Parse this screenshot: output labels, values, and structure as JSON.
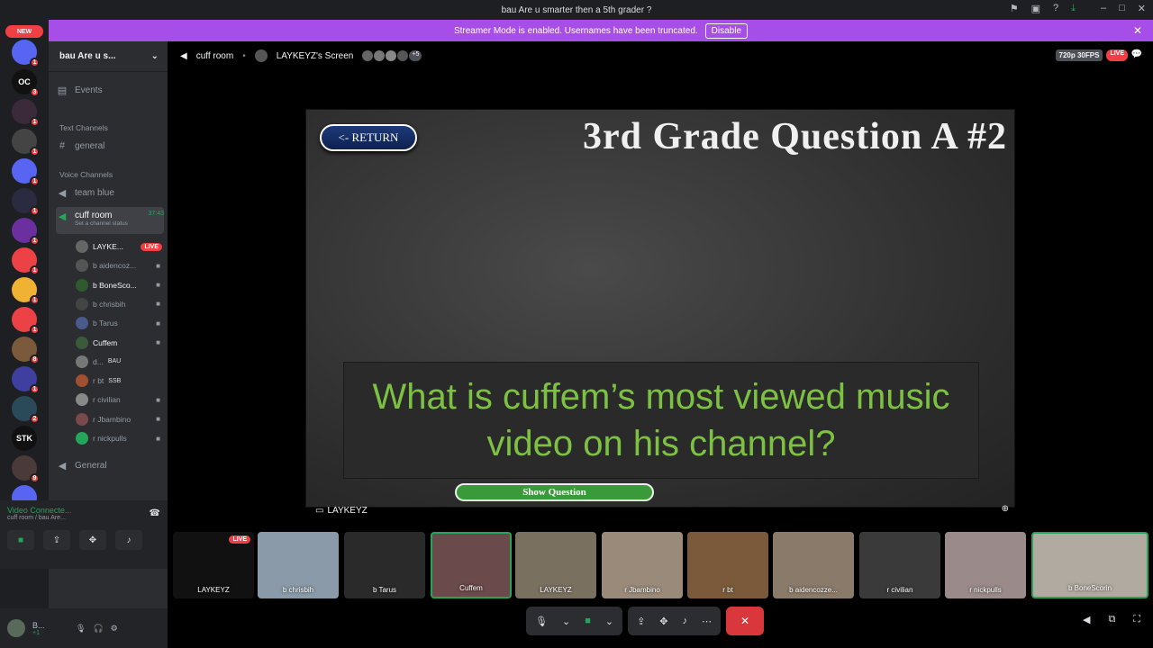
{
  "window": {
    "title": "bau Are u smarter then a 5th grader ?"
  },
  "banner": {
    "text": "Streamer Mode is enabled. Usernames have been truncated.",
    "button": "Disable"
  },
  "servers": [
    {
      "label": "",
      "badge": "1",
      "color": "#5865f2"
    },
    {
      "label": "OC",
      "badge": "3",
      "color": "#111"
    },
    {
      "label": "",
      "badge": "1",
      "color": "#3b2a3a"
    },
    {
      "label": "",
      "badge": "1",
      "color": "#444"
    },
    {
      "label": "",
      "badge": "1",
      "color": "#5865f2"
    },
    {
      "label": "",
      "badge": "1",
      "color": "#2a2a40"
    },
    {
      "label": "",
      "badge": "1",
      "color": "#6b2fa0"
    },
    {
      "label": "",
      "badge": "1",
      "color": "#ed4245"
    },
    {
      "label": "",
      "badge": "1",
      "color": "#f0b232"
    },
    {
      "label": "",
      "badge": "1",
      "color": "#ed4245"
    },
    {
      "label": "",
      "badge": "8",
      "color": "#7a5a3a"
    },
    {
      "label": "",
      "badge": "1",
      "color": "#3f3fa0"
    },
    {
      "label": "",
      "badge": "2",
      "color": "#2a4a5a"
    },
    {
      "label": "STK",
      "badge": "",
      "color": "#111"
    },
    {
      "label": "",
      "badge": "9",
      "color": "#4a3a3a"
    },
    {
      "label": "",
      "badge": "",
      "color": "#5865f2"
    }
  ],
  "new_label": "NEW",
  "guild": {
    "name": "bau Are u s..."
  },
  "sidebar": {
    "events": "Events",
    "text_category": "Text Channels",
    "general": "general",
    "voice_category": "Voice Channels",
    "team_blue": "team blue",
    "cuff_room": "cuff room",
    "timer": "37:43",
    "status_hint": "Set a channel status",
    "general2": "General"
  },
  "voice_users": [
    {
      "name": "LAYKE...",
      "tag": "LIVE"
    },
    {
      "name": "b aidencoz...",
      "tag": ""
    },
    {
      "name": "b BoneSco...",
      "tag": ""
    },
    {
      "name": "b chrisbih",
      "tag": ""
    },
    {
      "name": "b Tarus",
      "tag": ""
    },
    {
      "name": "Cuffem",
      "tag": ""
    },
    {
      "name": "d...",
      "tag": "BAU"
    },
    {
      "name": "r bt",
      "tag": "SSB"
    },
    {
      "name": "r civilian",
      "tag": ""
    },
    {
      "name": "r Jbambino",
      "tag": ""
    },
    {
      "name": "r nickpulls",
      "tag": ""
    }
  ],
  "voice_panel": {
    "status": "Video Connecte...",
    "location": "cuff room / bau Are..."
  },
  "user_panel": {
    "name": "B...",
    "sub": "+1"
  },
  "stage_header": {
    "channel": "cuff room",
    "screen": "LAYKEYZ's Screen",
    "more": "+5",
    "quality": "720p 30FPS",
    "live": "LIVE"
  },
  "board": {
    "return_label": "<- RETURN",
    "title": "3rd Grade Question A #2",
    "question": "What is cuffem’s most viewed music video on his channel?",
    "show_button": "Show Question"
  },
  "stream_name": "LAYKEYZ",
  "tiles": [
    {
      "name": "LAYKEYZ",
      "color": "#111",
      "live": "LIVE"
    },
    {
      "name": "b chrisbih",
      "color": "#8a9aa8",
      "live": ""
    },
    {
      "name": "b Tarus",
      "color": "#2a2a2a",
      "live": ""
    },
    {
      "name": "Cuffem",
      "color": "#6a4a4a",
      "live": ""
    },
    {
      "name": "LAYKEYZ",
      "color": "#7a7060",
      "live": ""
    },
    {
      "name": "r Jbambino",
      "color": "#9a8a7a",
      "live": ""
    },
    {
      "name": "r bt",
      "color": "#7a5a3a",
      "live": ""
    },
    {
      "name": "b aidencozze...",
      "color": "#8a7a6a",
      "live": ""
    },
    {
      "name": "r civilian",
      "color": "#3a3a3a",
      "live": ""
    },
    {
      "name": "r nickpulls",
      "color": "#9a8a8a",
      "live": ""
    },
    {
      "name": "b BoneScorin",
      "color": "#b0aaa0",
      "live": ""
    }
  ]
}
